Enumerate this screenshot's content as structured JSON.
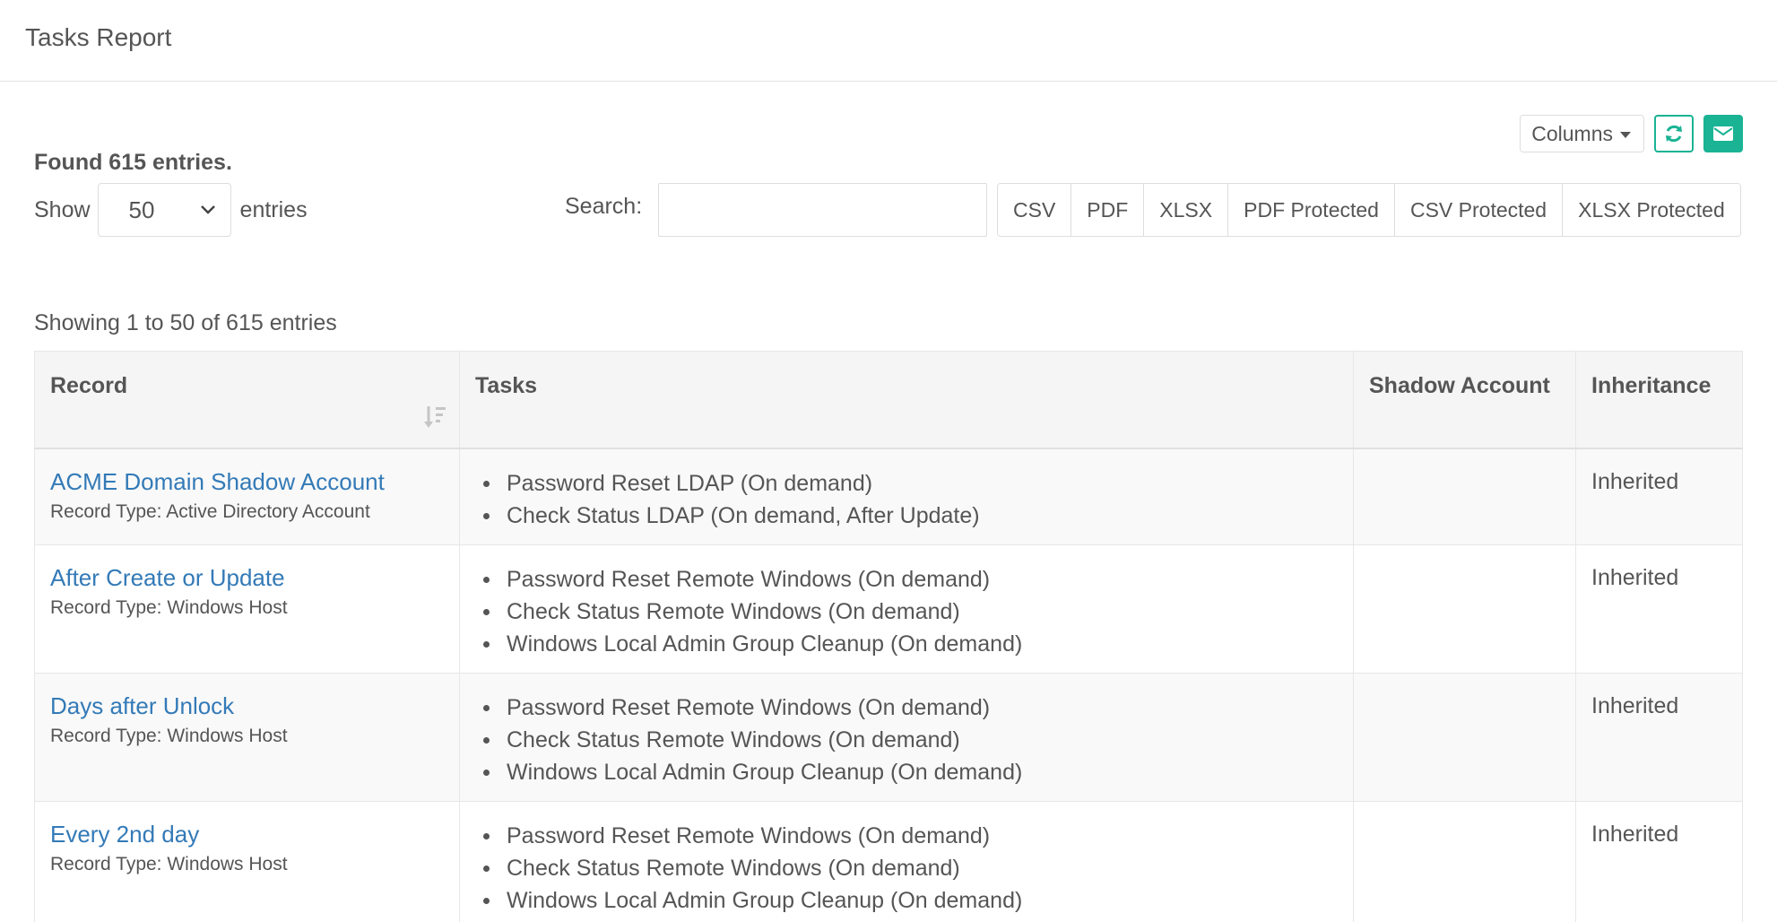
{
  "header": {
    "title": "Tasks Report"
  },
  "summary": {
    "found": "Found 615 entries."
  },
  "toolbar": {
    "columns_label": "Columns"
  },
  "length": {
    "show_label": "Show",
    "value": "50",
    "entries_label": "entries"
  },
  "search": {
    "label": "Search:",
    "value": "",
    "placeholder": ""
  },
  "exports": [
    "CSV",
    "PDF",
    "XLSX",
    "PDF Protected",
    "CSV Protected",
    "XLSX Protected"
  ],
  "info": {
    "showing": "Showing 1 to 50 of 615 entries"
  },
  "table": {
    "headers": {
      "record": "Record",
      "tasks": "Tasks",
      "shadow": "Shadow Account",
      "inheritance": "Inheritance"
    },
    "rows": [
      {
        "record": "ACME Domain Shadow Account",
        "record_type": "Record Type: Active Directory Account",
        "tasks": [
          "Password Reset LDAP (On demand)",
          "Check Status LDAP (On demand, After Update)"
        ],
        "shadow": "",
        "inheritance": "Inherited"
      },
      {
        "record": "After Create or Update",
        "record_type": "Record Type: Windows Host",
        "tasks": [
          "Password Reset Remote Windows (On demand)",
          "Check Status Remote Windows (On demand)",
          "Windows Local Admin Group Cleanup (On demand)"
        ],
        "shadow": "",
        "inheritance": "Inherited"
      },
      {
        "record": "Days after Unlock",
        "record_type": "Record Type: Windows Host",
        "tasks": [
          "Password Reset Remote Windows (On demand)",
          "Check Status Remote Windows (On demand)",
          "Windows Local Admin Group Cleanup (On demand)"
        ],
        "shadow": "",
        "inheritance": "Inherited"
      },
      {
        "record": "Every 2nd day",
        "record_type": "Record Type: Windows Host",
        "tasks": [
          "Password Reset Remote Windows (On demand)",
          "Check Status Remote Windows (On demand)",
          "Windows Local Admin Group Cleanup (On demand)"
        ],
        "shadow": "",
        "inheritance": "Inherited"
      }
    ]
  },
  "colors": {
    "accent": "#1ab394",
    "link": "#337ab7",
    "text": "#555555"
  }
}
